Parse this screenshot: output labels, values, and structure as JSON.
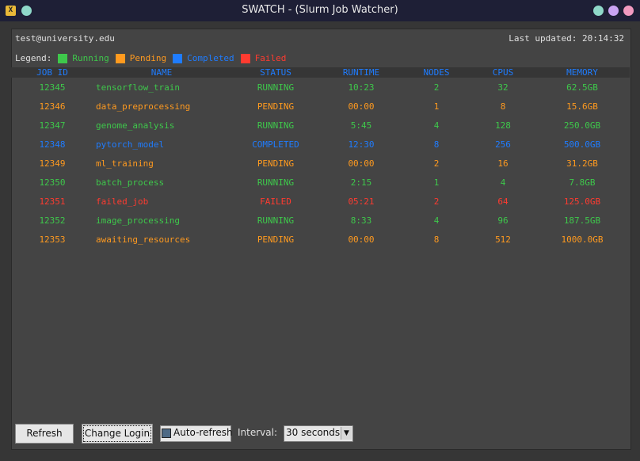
{
  "window": {
    "title": "SWATCH - (Slurm Job Watcher)",
    "app_icon_glyph": "X"
  },
  "colors": {
    "running": "#3ec84b",
    "pending": "#ff9a1f",
    "completed": "#1f7cff",
    "failed": "#ff3b30"
  },
  "header": {
    "user": "test@university.edu",
    "last_updated": "Last updated: 20:14:32"
  },
  "legend": {
    "label": "Legend:",
    "items": [
      {
        "label": "Running",
        "color": "#3ec84b"
      },
      {
        "label": "Pending",
        "color": "#ff9a1f"
      },
      {
        "label": "Completed",
        "color": "#1f7cff"
      },
      {
        "label": "Failed",
        "color": "#ff3b30"
      }
    ]
  },
  "table": {
    "columns": [
      "JOB ID",
      "NAME",
      "STATUS",
      "RUNTIME",
      "NODES",
      "CPUS",
      "MEMORY"
    ],
    "rows": [
      [
        "12345",
        "tensorflow_train",
        "RUNNING",
        "10:23",
        "2",
        "32",
        "62.5GB"
      ],
      [
        "12346",
        "data_preprocessing",
        "PENDING",
        "00:00",
        "1",
        "8",
        "15.6GB"
      ],
      [
        "12347",
        "genome_analysis",
        "RUNNING",
        "5:45",
        "4",
        "128",
        "250.0GB"
      ],
      [
        "12348",
        "pytorch_model",
        "COMPLETED",
        "12:30",
        "8",
        "256",
        "500.0GB"
      ],
      [
        "12349",
        "ml_training",
        "PENDING",
        "00:00",
        "2",
        "16",
        "31.2GB"
      ],
      [
        "12350",
        "batch_process",
        "RUNNING",
        "2:15",
        "1",
        "4",
        "7.8GB"
      ],
      [
        "12351",
        "failed_job",
        "FAILED",
        "05:21",
        "2",
        "64",
        "125.0GB"
      ],
      [
        "12352",
        "image_processing",
        "RUNNING",
        "8:33",
        "4",
        "96",
        "187.5GB"
      ],
      [
        "12353",
        "awaiting_resources",
        "PENDING",
        "00:00",
        "8",
        "512",
        "1000.0GB"
      ]
    ]
  },
  "controls": {
    "refresh_label": "Refresh",
    "change_login_label": "Change Login",
    "auto_refresh_label": "Auto-refresh",
    "auto_refresh_checked": true,
    "interval_label": "Interval:",
    "interval_value": "30 seconds"
  }
}
